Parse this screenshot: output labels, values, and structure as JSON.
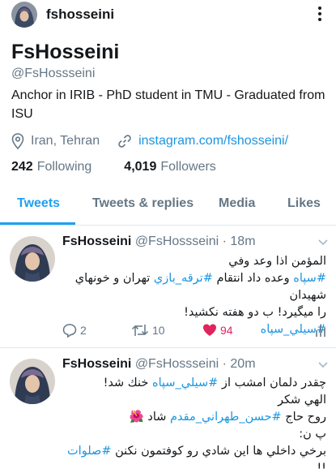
{
  "topbar": {
    "handle": "fshosseini"
  },
  "profile": {
    "name": "FsHosseini",
    "handle": "@FsHossseini",
    "bio": "Anchor in IRIB - PhD student in TMU - Graduated from ISU",
    "location": "Iran, Tehran",
    "website": "instagram.com/fshosseini/",
    "following_count": "242",
    "following_label": "Following",
    "followers_count": "4,019",
    "followers_label": "Followers"
  },
  "tabs": [
    "Tweets",
    "Tweets & replies",
    "Media",
    "Likes"
  ],
  "tweets": [
    {
      "name": "FsHosseini",
      "meta": "@FsHossseini · 18m",
      "lines": [
        "المؤمن اذا وعد وفي",
        "#سپاه وعده داد انتقام #ترقه_بازي تهران و خونهاي شهيدان",
        "را ميگيرد! ب دو هفته نكشيد!",
        "#سيلي_سپاه"
      ],
      "l1_tag1": "#سپاه",
      "l1_mid": " وعده داد انتقام ",
      "l1_tag2": "#ترقه_بازي",
      "l1_end": " تهران و خونهاي شهيدان",
      "replies": "2",
      "retweets": "10",
      "likes": "94"
    },
    {
      "name": "FsHosseini",
      "meta": "@FsHossseini · 20m",
      "l0_start": "چقدر دلمان امشب از ",
      "l0_tag": "#سيلي_سپاه",
      "l0_end": " خنك شد!",
      "l1": "الهي شكر",
      "l2_start": "روح حاج ",
      "l2_tag": "#حسن_طهراني_مقدم",
      "l2_end": " شاد",
      "l2_emoji": "🌺",
      "l3": "پ ن:",
      "l4_start": "برخي داخلي ها اين شادي رو كوفتمون نكنن ",
      "l4_tag": "#صلوات",
      "l4_end": " !!"
    }
  ],
  "colors": {
    "accent": "#1da1f2",
    "link": "#1b95e0",
    "like": "#e0245e",
    "muted": "#657786"
  },
  "icons": [
    "more-vertical-icon",
    "location-pin-icon",
    "link-icon",
    "chevron-down-icon",
    "reply-icon",
    "retweet-icon",
    "heart-icon",
    "analytics-icon"
  ]
}
